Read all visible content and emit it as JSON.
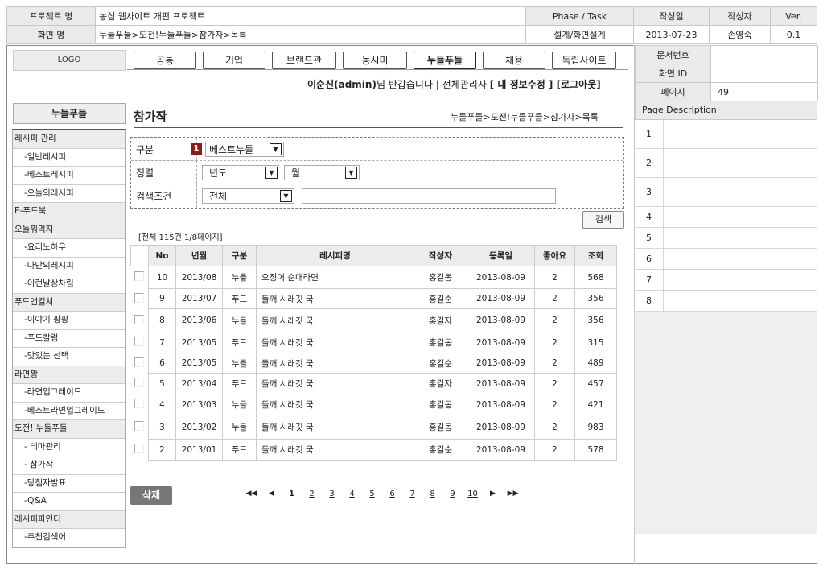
{
  "header": {
    "project_label": "프로젝트 명",
    "project_value": "농심 웹사이트 개편 프로젝트",
    "phase_label": "Phase / Task",
    "date_label": "작성일",
    "author_label": "작성자",
    "ver_label": "Ver.",
    "screen_label": "화면 명",
    "screen_value": "누들푸들>도전!누들푸들>참가자>목록",
    "phase_value": "설계/화면설계",
    "date_value": "2013-07-23",
    "author_value": "손영숙",
    "ver_value": "0.1",
    "docno_label": "문서번호",
    "docno_value": "",
    "screenid_label": "화면 ID",
    "screenid_value": "",
    "page_label": "페이지",
    "page_value": "49"
  },
  "logo": "LOGO",
  "nav": [
    "공통",
    "기업",
    "브랜드관",
    "농시미",
    "누들푸들",
    "채용",
    "독립사이트"
  ],
  "nav_active": 4,
  "welcome": {
    "user": "이순신(admin)",
    "greeting": "님 반갑습니다 | 전체관리자",
    "links": "[ 내 정보수정 ] [로그아웃]"
  },
  "sidebar": {
    "title": "누들푸들",
    "items": [
      {
        "type": "cat",
        "label": "레시피 관리"
      },
      {
        "type": "sub",
        "label": "-일반레시피"
      },
      {
        "type": "sub",
        "label": "-베스트레시피"
      },
      {
        "type": "sub",
        "label": "-오늘의레시피"
      },
      {
        "type": "cat",
        "label": "E-푸드북"
      },
      {
        "type": "cat",
        "label": "오늘뭐먹지"
      },
      {
        "type": "sub",
        "label": "-요리노하우"
      },
      {
        "type": "sub",
        "label": "-나만의레시피"
      },
      {
        "type": "sub",
        "label": "-이런날상차림"
      },
      {
        "type": "cat",
        "label": "푸드앤컬쳐"
      },
      {
        "type": "sub",
        "label": "-이야기 팡팡"
      },
      {
        "type": "sub",
        "label": "-푸드칼럼"
      },
      {
        "type": "sub",
        "label": "-맛있는 선택"
      },
      {
        "type": "cat",
        "label": "라면짱"
      },
      {
        "type": "sub",
        "label": "-라면업그레이드"
      },
      {
        "type": "sub",
        "label": "-베스트라면업그레이드"
      },
      {
        "type": "cat",
        "label": "도전! 누들푸들"
      },
      {
        "type": "sub",
        "label": "- 테마관리"
      },
      {
        "type": "sub",
        "label": "- 참가작"
      },
      {
        "type": "sub",
        "label": "-당첨자발표"
      },
      {
        "type": "sub",
        "label": "-Q&A"
      },
      {
        "type": "cat",
        "label": "레시피파인더"
      },
      {
        "type": "sub",
        "label": "-추천검색어"
      }
    ]
  },
  "page": {
    "title": "참가작",
    "breadcrumb": "누들푸들>도전!누들푸들>참가자>목록"
  },
  "filter": {
    "type_label": "구분",
    "type_badge": "1",
    "type_value": "베스트누들",
    "sort_label": "정렬",
    "sort_year": "년도",
    "sort_month": "월",
    "search_label": "검색조건",
    "search_value": "전체",
    "search_text": "",
    "search_button": "검색"
  },
  "count_text": "[전체 115건 1/8페이지]",
  "table": {
    "headers": [
      "No",
      "년월",
      "구분",
      "레시피명",
      "작성자",
      "등록일",
      "좋아요",
      "조회"
    ],
    "rows": [
      [
        "10",
        "2013/08",
        "누들",
        "오징어 순대라면",
        "홍길동",
        "2013-08-09",
        "2",
        "568"
      ],
      [
        "9",
        "2013/07",
        "푸드",
        "들깨 시래깃 국",
        "홍길순",
        "2013-08-09",
        "2",
        "356"
      ],
      [
        "8",
        "2013/06",
        "누들",
        "들깨 시래깃 국",
        "홍길자",
        "2013-08-09",
        "2",
        "356"
      ],
      [
        "7",
        "2013/05",
        "푸드",
        "들깨 시래깃 국",
        "홍길동",
        "2013-08-09",
        "2",
        "315"
      ],
      [
        "6",
        "2013/05",
        "누들",
        "들깨 시래깃 국",
        "홍길순",
        "2013-08-09",
        "2",
        "489"
      ],
      [
        "5",
        "2013/04",
        "푸드",
        "들깨 시래깃 국",
        "홍길자",
        "2013-08-09",
        "2",
        "457"
      ],
      [
        "4",
        "2013/03",
        "누들",
        "들깨 시래깃 국",
        "홍길동",
        "2013-08-09",
        "2",
        "421"
      ],
      [
        "3",
        "2013/02",
        "누들",
        "들깨 시래깃 국",
        "홍길동",
        "2013-08-09",
        "2",
        "983"
      ],
      [
        "2",
        "2013/01",
        "푸드",
        "들깨 시래깃 국",
        "홍길순",
        "2013-08-09",
        "2",
        "578"
      ]
    ]
  },
  "delete_button": "삭제",
  "pager": {
    "first": "◀◀",
    "prev": "◀",
    "pages": [
      "1",
      "2",
      "3",
      "4",
      "5",
      "6",
      "7",
      "8",
      "9",
      "10"
    ],
    "current": "1",
    "next": "▶",
    "last": "▶▶"
  },
  "page_description": {
    "title": "Page Description",
    "numbers": [
      "1",
      "2",
      "3",
      "4",
      "5",
      "6",
      "7",
      "8"
    ]
  },
  "colors": {
    "badge": "#8b1a1a",
    "delete_button": "#777777",
    "header_gray": "#eaeaea"
  }
}
